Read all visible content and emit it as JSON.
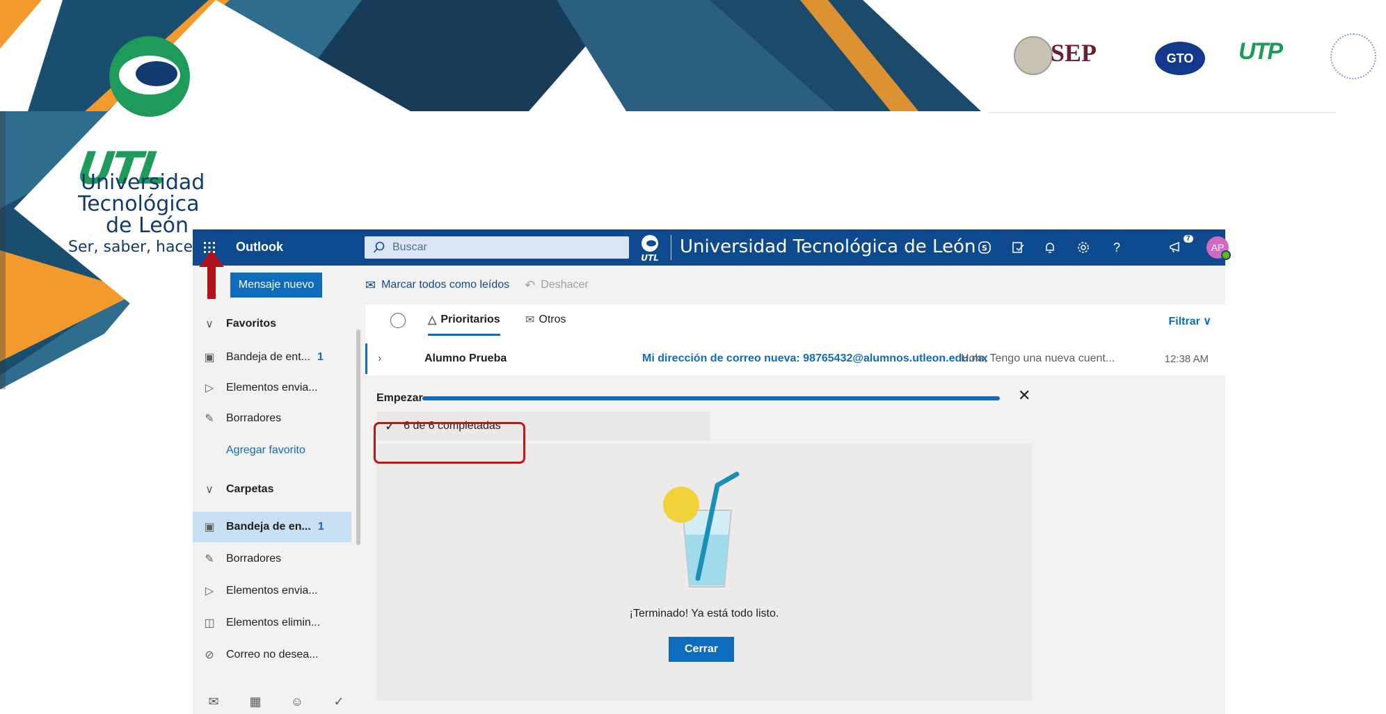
{
  "banner": {
    "brand": "UTL",
    "brand_lines": [
      "Universidad",
      "Tecnológica",
      "de León",
      "Ser, saber, hacer"
    ],
    "partner_logos": [
      "SEP",
      "GTO",
      "UTP"
    ],
    "colors": {
      "navy": "#123a6f",
      "teal": "#1e9a5a",
      "orange": "#f29a2e",
      "steel": "#2f6d8f"
    }
  },
  "outlook": {
    "app_name": "Outlook",
    "search_placeholder": "Buscar",
    "org_name": "Universidad Tecnológica de León",
    "org_logo_text": "UTL",
    "header_icons": [
      "skype-icon",
      "todo-icon",
      "bell-icon",
      "gear-icon",
      "help-icon",
      "megaphone-icon"
    ],
    "megaphone_badge": "7",
    "avatar_initials": "AP",
    "new_message": "Mensaje nuevo",
    "nav": {
      "favorites": "Favoritos",
      "fav_items": [
        {
          "label": "Bandeja de ent...",
          "count": "1"
        },
        {
          "label": "Elementos envia...",
          "count": ""
        },
        {
          "label": "Borradores",
          "count": ""
        }
      ],
      "add_favorite": "Agregar favorito",
      "folders": "Carpetas",
      "folder_items": [
        {
          "label": "Bandeja de en...",
          "count": "1"
        },
        {
          "label": "Borradores",
          "count": ""
        },
        {
          "label": "Elementos envia...",
          "count": ""
        },
        {
          "label": "Elementos elimin...",
          "count": ""
        },
        {
          "label": "Correo no desea...",
          "count": ""
        }
      ]
    },
    "commands": {
      "mark_all_read": "Marcar todos como leídos",
      "undo": "Deshacer"
    },
    "tabs": {
      "focused": "Prioritarios",
      "other": "Otros"
    },
    "filter": "Filtrar",
    "message": {
      "from": "Alumno Prueba",
      "subject": "Mi dirección de correo nueva: 98765432@alumnos.utleon.edu.mx",
      "preview": "Hola, Tengo una nueva cuent...",
      "time": "12:38 AM"
    },
    "get_started": {
      "label": "Empezar",
      "progress": 1.0,
      "completed": "6 de 6 completadas",
      "finished_text": "¡Terminado! Ya está todo listo.",
      "close_button": "Cerrar"
    }
  }
}
